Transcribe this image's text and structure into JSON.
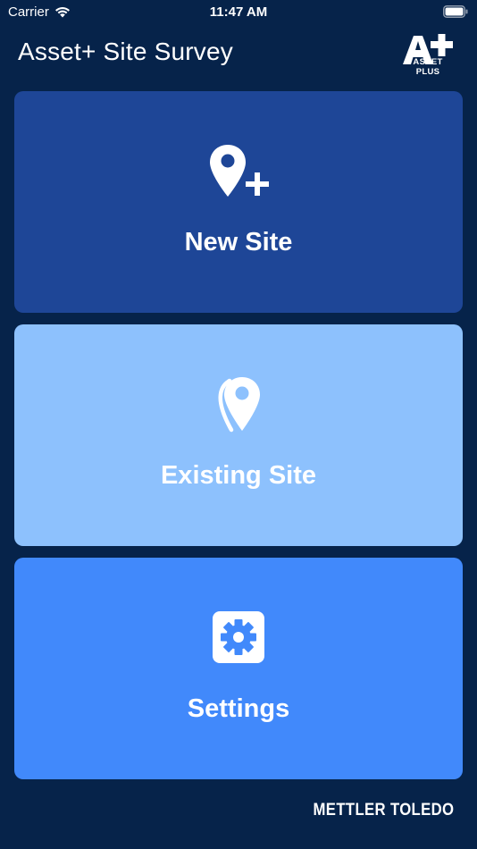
{
  "status_bar": {
    "carrier": "Carrier",
    "time": "11:47 AM"
  },
  "header": {
    "title": "Asset+ Site Survey",
    "logo_text": "ASSET PLUS"
  },
  "tiles": [
    {
      "label": "New Site",
      "icon": "location-plus-icon",
      "color": "#1e4697"
    },
    {
      "label": "Existing Site",
      "icon": "location-pin-icon",
      "color": "#8dc1fd"
    },
    {
      "label": "Settings",
      "icon": "gear-icon",
      "color": "#4189fb"
    }
  ],
  "footer": {
    "brand": "METTLER TOLEDO"
  },
  "colors": {
    "background": "#06234a",
    "text": "#ffffff"
  }
}
